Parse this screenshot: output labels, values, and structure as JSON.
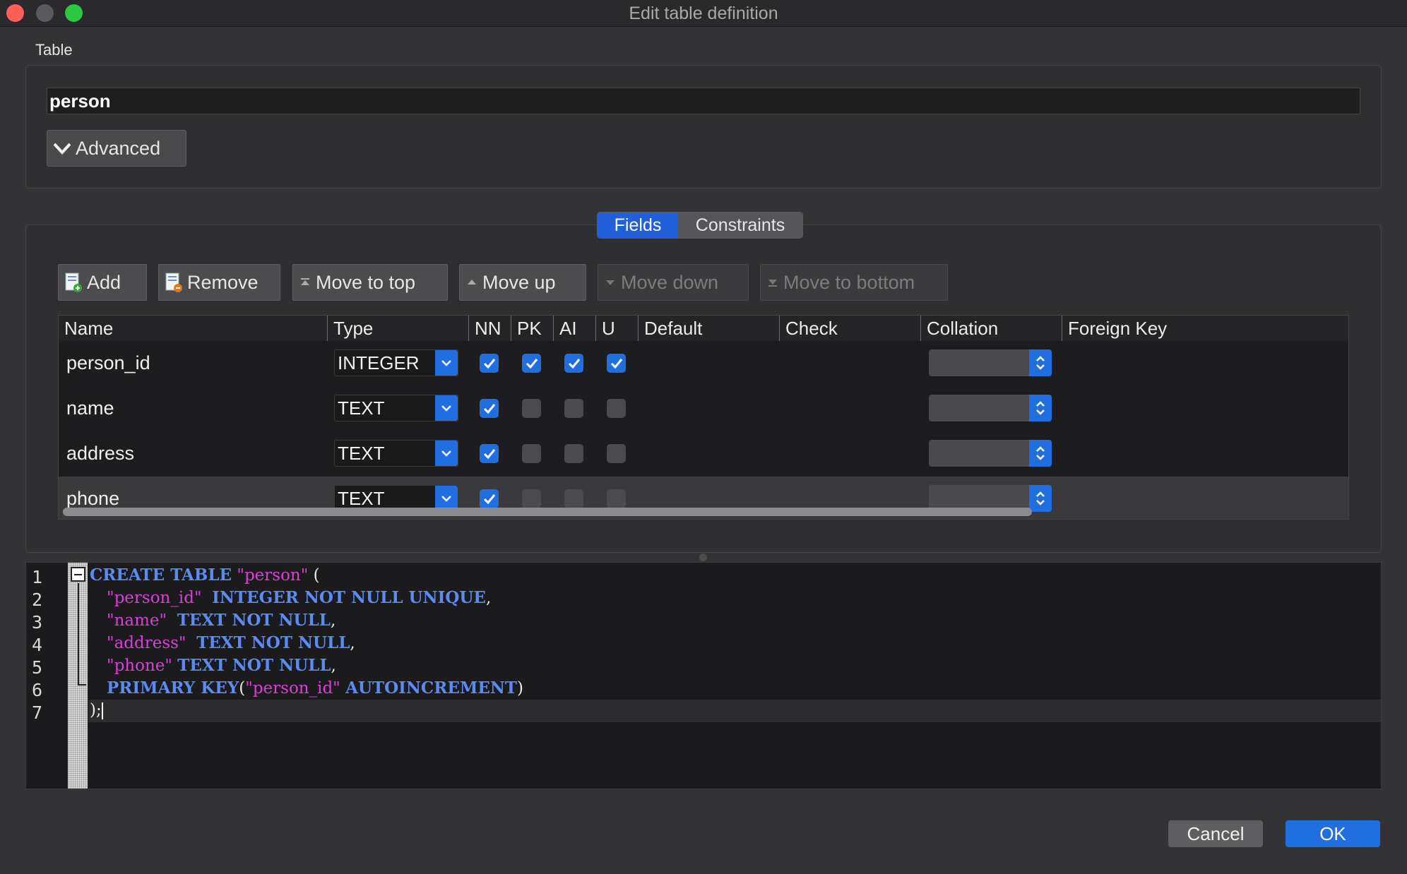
{
  "window": {
    "title": "Edit table definition"
  },
  "table_group": {
    "label": "Table",
    "name_value": "person",
    "advanced_label": "Advanced"
  },
  "tabs": [
    {
      "label": "Fields",
      "active": true
    },
    {
      "label": "Constraints",
      "active": false
    }
  ],
  "toolbar": {
    "add": "Add",
    "remove": "Remove",
    "move_to_top": "Move to top",
    "move_up": "Move up",
    "move_down": "Move down",
    "move_to_bottom": "Move to bottom"
  },
  "grid": {
    "columns": [
      "Name",
      "Type",
      "NN",
      "PK",
      "AI",
      "U",
      "Default",
      "Check",
      "Collation",
      "Foreign Key"
    ],
    "rows": [
      {
        "name": "person_id",
        "type": "INTEGER",
        "nn": true,
        "pk": true,
        "ai": true,
        "u": true
      },
      {
        "name": "name",
        "type": "TEXT",
        "nn": true,
        "pk": false,
        "ai": false,
        "u": false
      },
      {
        "name": "address",
        "type": "TEXT",
        "nn": true,
        "pk": false,
        "ai": false,
        "u": false
      },
      {
        "name": "phone",
        "type": "TEXT",
        "nn": true,
        "pk": false,
        "ai": false,
        "u": false
      }
    ]
  },
  "sql": {
    "line_numbers": [
      "1",
      "2",
      "3",
      "4",
      "5",
      "6",
      "7"
    ],
    "l1_kw": "CREATE TABLE",
    "l1_str": "\"person\"",
    "l1_end": " (",
    "l2_str": "\"person_id\"",
    "l2_kw": "INTEGER NOT NULL UNIQUE",
    "l2_end": ",",
    "l3_str": "\"name\"",
    "l3_kw": "TEXT NOT NULL",
    "l3_end": ",",
    "l4_str": "\"address\"",
    "l4_kw": "TEXT NOT NULL",
    "l4_end": ",",
    "l5_str": "\"phone\"",
    "l5_kw": "TEXT NOT NULL",
    "l5_end": ",",
    "l6_kw1": "PRIMARY KEY",
    "l6_open": "(",
    "l6_str": "\"person_id\"",
    "l6_kw2": "AUTOINCREMENT",
    "l6_close": ")",
    "l7": ");"
  },
  "footer": {
    "cancel": "Cancel",
    "ok": "OK"
  },
  "colors": {
    "accent": "#1f6fe0",
    "keyword": "#5b8bf0",
    "string": "#d93fd6"
  }
}
